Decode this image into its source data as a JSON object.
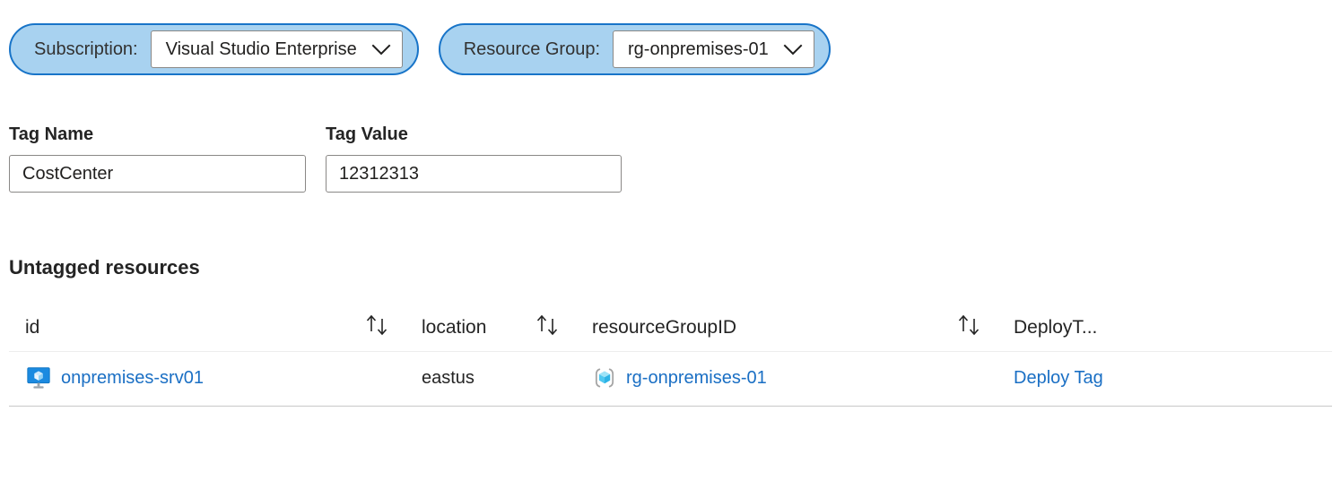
{
  "filters": [
    {
      "label": "Subscription:",
      "value": "Visual Studio Enterprise",
      "chevron_icon": "chevron-down-icon"
    },
    {
      "label": "Resource Group:",
      "value": "rg-onpremises-01",
      "chevron_icon": "chevron-down-icon"
    }
  ],
  "fields": {
    "tag_name": {
      "label": "Tag Name",
      "value": "CostCenter",
      "placeholder": "Tag Name"
    },
    "tag_value": {
      "label": "Tag Value",
      "value": "12312313",
      "placeholder": "Tag Value"
    }
  },
  "section": {
    "title": "Untagged resources"
  },
  "table": {
    "columns": [
      {
        "label": "id",
        "sortable": true,
        "sort_icon": "sort-ascending-descending-icon"
      },
      {
        "label": "location",
        "sortable": true,
        "sort_icon": "sort-ascending-descending-icon"
      },
      {
        "label": "resourceGroupID",
        "sortable": true,
        "sort_icon": "sort-ascending-descending-icon"
      },
      {
        "label": "DeployT...",
        "sortable": false,
        "sort_icon": ""
      }
    ],
    "rows": [
      {
        "id": "onpremises-srv01",
        "id_icon": "virtual-machine-icon",
        "location": "eastus",
        "resourceGroupID": "rg-onpremises-01",
        "resourceGroupID_icon": "resource-group-icon",
        "deploy_action": "Deploy Tag"
      }
    ]
  },
  "colors": {
    "pill_fill": "#a8d2f0",
    "pill_border": "#1874c8",
    "link": "#1a6fc4",
    "text": "#242424",
    "input_border": "#8a8886",
    "row_border": "#c8c8c8",
    "header_border": "#ededed"
  }
}
